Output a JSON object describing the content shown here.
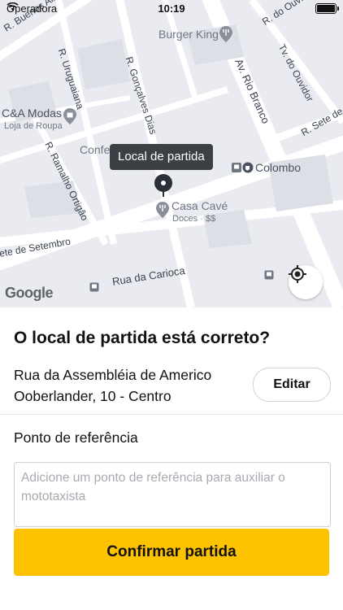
{
  "status_bar": {
    "carrier": "Operadora",
    "time": "10:19"
  },
  "map": {
    "streets": {
      "buenos_aires": "R. Buenos Aires",
      "do_ouvidor": "R. do Ouvid",
      "uruguaiana": "R. Uruguaiana",
      "goncalves_dias": "R. Gonçalves Dias",
      "rio_branco": "Av. Rio Branco",
      "tv_ouvidor": "Tv. do Ouvidor",
      "sete_de_se": "R. Sete de Se",
      "ramalho_ortigao": "R. Ramalho Ortigão",
      "sete_de_setembro": "ete de Setembro",
      "carioca": "Rua da Carioca"
    },
    "pois": {
      "burger_king": "Burger King",
      "ca_modas": "C&A Modas",
      "ca_modas_sub": "Loja de Roupa",
      "confe": "Confe",
      "colombo": "Colombo",
      "casa_cave": "Casa Cavé",
      "casa_cave_sub": "Doces · $$"
    },
    "tooltip": "Local de partida",
    "attribution": "Google"
  },
  "panel": {
    "title": "O local de partida está correto?",
    "address": "Rua da Assembléia de Americo Ooberlander, 10 - Centro",
    "edit_label": "Editar",
    "reference_label": "Ponto de referência",
    "reference_placeholder": "Adicione um ponto de referência para auxiliar o mototaxista",
    "confirm_label": "Confirmar partida"
  },
  "colors": {
    "accent": "#fec300",
    "map_bg": "#e9ebf0",
    "tooltip_bg": "#3c3f44"
  }
}
